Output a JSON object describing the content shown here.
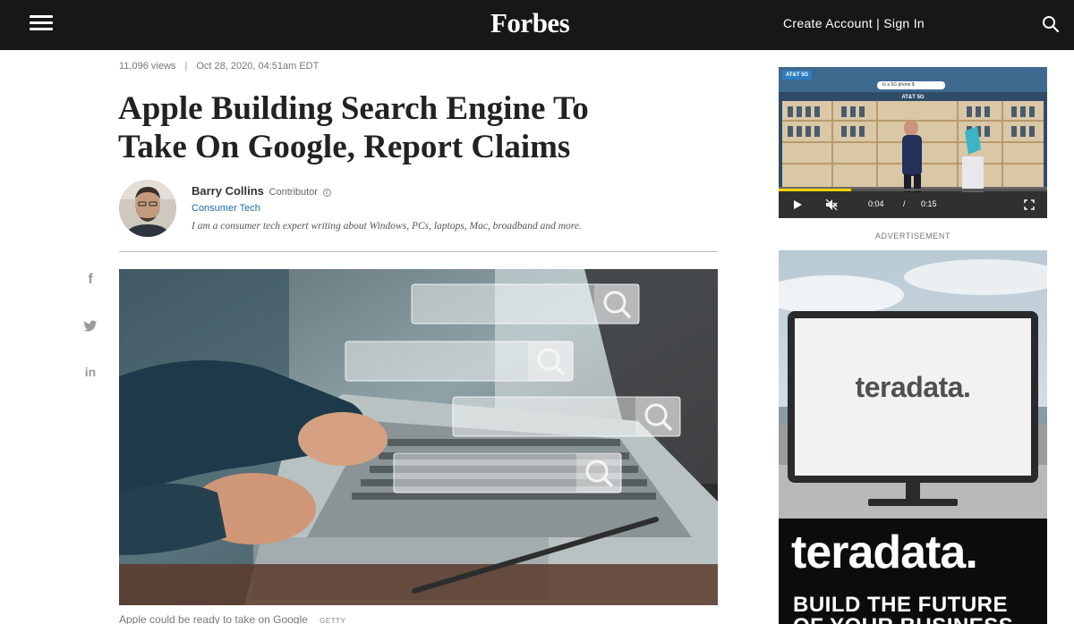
{
  "header": {
    "logo": "Forbes",
    "create_account": "Create Account",
    "separator": "|",
    "sign_in": "Sign In"
  },
  "article": {
    "views": "11,096 views",
    "meta_separator": "|",
    "date": "Oct 28, 2020, 04:51am EDT",
    "headline_line1": "Apple Building Search Engine To",
    "headline_line2": "Take On Google, Report Claims",
    "author": {
      "name": "Barry Collins",
      "role": "Contributor",
      "info_glyph": "i",
      "channel": "Consumer Tech",
      "bio": "I am a consumer tech expert writing about Windows, PCs, laptops, Mac, broadband and more."
    },
    "caption": "Apple could be ready to take on Google",
    "credit": "GETTY"
  },
  "social": {
    "facebook": "f",
    "twitter": "❛",
    "linkedin": "in"
  },
  "video": {
    "brand_tag": "AT&T 5G",
    "search_text": "Is a 5G phone $",
    "store_sign": "AT&T 5G",
    "time_current": "0:04",
    "time_separator": "/",
    "time_total": "0:15",
    "progress": 0.27
  },
  "ad": {
    "label": "ADVERTISEMENT",
    "screen_logo": "teradata.",
    "banner_logo": "teradata.",
    "tagline_line1": "BUILD THE FUTURE",
    "tagline_line2": "OF YOUR BUSINESS"
  },
  "colors": {
    "header_bg": "#181716",
    "link_blue": "#1a6ca8",
    "teradata_orange": "#f37440",
    "video_progress": "#f6d100"
  }
}
